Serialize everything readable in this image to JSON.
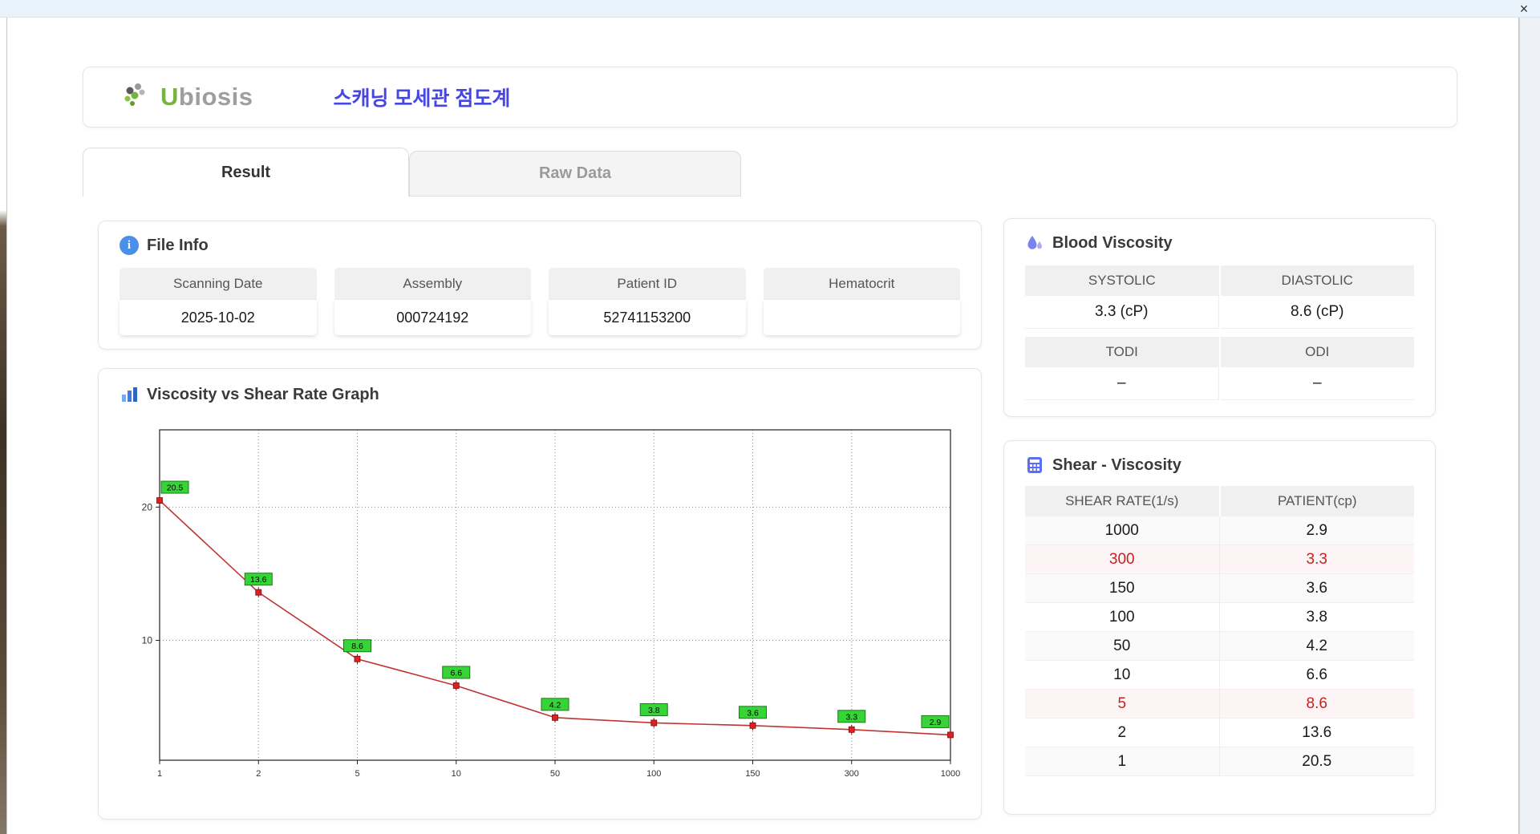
{
  "window": {
    "close_label": "×"
  },
  "header": {
    "logo_first": "U",
    "logo_rest": "biosis",
    "title": "스캐닝 모세관 점도계"
  },
  "tabs": {
    "result": "Result",
    "raw_data": "Raw Data"
  },
  "file_info": {
    "title": "File Info",
    "fields": [
      {
        "label": "Scanning Date",
        "value": "2025-10-02"
      },
      {
        "label": "Assembly",
        "value": "000724192"
      },
      {
        "label": "Patient ID",
        "value": "52741153200"
      },
      {
        "label": "Hematocrit",
        "value": ""
      }
    ]
  },
  "blood_viscosity": {
    "title": "Blood Viscosity",
    "row1": {
      "h1": "SYSTOLIC",
      "h2": "DIASTOLIC",
      "v1": "3.3 (cP)",
      "v2": "8.6 (cP)"
    },
    "row2": {
      "h1": "TODI",
      "h2": "ODI",
      "v1": "–",
      "v2": "–"
    }
  },
  "shear_viscosity": {
    "title": "Shear - Viscosity",
    "columns": {
      "shear": "SHEAR RATE(1/s)",
      "patient": "PATIENT(cp)"
    },
    "rows": [
      {
        "shear": "1000",
        "patient": "2.9",
        "highlight": false
      },
      {
        "shear": "300",
        "patient": "3.3",
        "highlight": true
      },
      {
        "shear": "150",
        "patient": "3.6",
        "highlight": false
      },
      {
        "shear": "100",
        "patient": "3.8",
        "highlight": false
      },
      {
        "shear": "50",
        "patient": "4.2",
        "highlight": false
      },
      {
        "shear": "10",
        "patient": "6.6",
        "highlight": false
      },
      {
        "shear": "5",
        "patient": "8.6",
        "highlight": true
      },
      {
        "shear": "2",
        "patient": "13.6",
        "highlight": false
      },
      {
        "shear": "1",
        "patient": "20.5",
        "highlight": false
      }
    ]
  },
  "chart_data": {
    "type": "line",
    "title": "Viscosity vs Shear Rate Graph",
    "x_ticks": [
      "1",
      "2",
      "5",
      "10",
      "50",
      "100",
      "150",
      "300",
      "1000"
    ],
    "values": [
      20.5,
      13.6,
      8.6,
      6.6,
      4.2,
      3.8,
      3.6,
      3.3,
      2.9
    ],
    "ylim": [
      1,
      25.8
    ],
    "y_gridlines": [
      10,
      20
    ],
    "grid": "dotted",
    "x_scale": "log ticks evenly spaced",
    "legend": "none",
    "colors": {
      "line": "#c03434",
      "marker": "#e02020",
      "marker_border": "#7a0a0a",
      "label_bg": "#37d437",
      "label_border": "#1a7a1a",
      "grid_line": "#8a8a8a",
      "axis": "#222222"
    }
  }
}
